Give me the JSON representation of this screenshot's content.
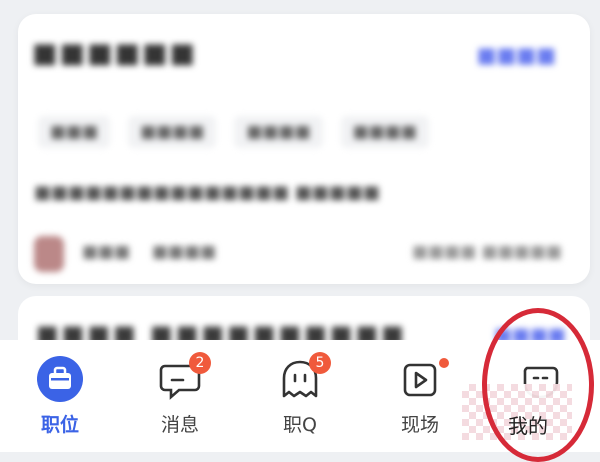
{
  "tabs": [
    {
      "label": "职位",
      "icon": "briefcase-icon",
      "active": true
    },
    {
      "label": "消息",
      "icon": "message-icon",
      "badge": "2"
    },
    {
      "label": "职Q",
      "icon": "chat-bubble-icon",
      "badge": "5"
    },
    {
      "label": "现场",
      "icon": "play-icon",
      "dot": true
    },
    {
      "label": "我的",
      "icon": "profile-face-icon"
    }
  ],
  "colors": {
    "accent": "#3b63e6",
    "badge": "#f05a3c",
    "annotation": "#d62a38"
  }
}
